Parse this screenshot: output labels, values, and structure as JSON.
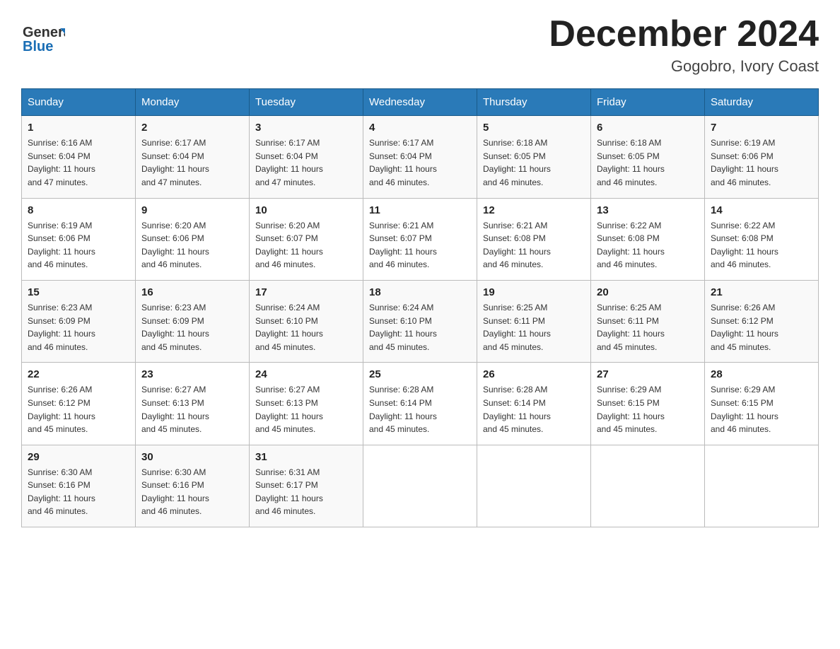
{
  "header": {
    "logo_text_general": "General",
    "logo_text_blue": "Blue",
    "month_title": "December 2024",
    "location": "Gogobro, Ivory Coast"
  },
  "weekdays": [
    "Sunday",
    "Monday",
    "Tuesday",
    "Wednesday",
    "Thursday",
    "Friday",
    "Saturday"
  ],
  "weeks": [
    [
      {
        "day": "1",
        "sunrise": "6:16 AM",
        "sunset": "6:04 PM",
        "daylight": "11 hours and 47 minutes."
      },
      {
        "day": "2",
        "sunrise": "6:17 AM",
        "sunset": "6:04 PM",
        "daylight": "11 hours and 47 minutes."
      },
      {
        "day": "3",
        "sunrise": "6:17 AM",
        "sunset": "6:04 PM",
        "daylight": "11 hours and 47 minutes."
      },
      {
        "day": "4",
        "sunrise": "6:17 AM",
        "sunset": "6:04 PM",
        "daylight": "11 hours and 46 minutes."
      },
      {
        "day": "5",
        "sunrise": "6:18 AM",
        "sunset": "6:05 PM",
        "daylight": "11 hours and 46 minutes."
      },
      {
        "day": "6",
        "sunrise": "6:18 AM",
        "sunset": "6:05 PM",
        "daylight": "11 hours and 46 minutes."
      },
      {
        "day": "7",
        "sunrise": "6:19 AM",
        "sunset": "6:06 PM",
        "daylight": "11 hours and 46 minutes."
      }
    ],
    [
      {
        "day": "8",
        "sunrise": "6:19 AM",
        "sunset": "6:06 PM",
        "daylight": "11 hours and 46 minutes."
      },
      {
        "day": "9",
        "sunrise": "6:20 AM",
        "sunset": "6:06 PM",
        "daylight": "11 hours and 46 minutes."
      },
      {
        "day": "10",
        "sunrise": "6:20 AM",
        "sunset": "6:07 PM",
        "daylight": "11 hours and 46 minutes."
      },
      {
        "day": "11",
        "sunrise": "6:21 AM",
        "sunset": "6:07 PM",
        "daylight": "11 hours and 46 minutes."
      },
      {
        "day": "12",
        "sunrise": "6:21 AM",
        "sunset": "6:08 PM",
        "daylight": "11 hours and 46 minutes."
      },
      {
        "day": "13",
        "sunrise": "6:22 AM",
        "sunset": "6:08 PM",
        "daylight": "11 hours and 46 minutes."
      },
      {
        "day": "14",
        "sunrise": "6:22 AM",
        "sunset": "6:08 PM",
        "daylight": "11 hours and 46 minutes."
      }
    ],
    [
      {
        "day": "15",
        "sunrise": "6:23 AM",
        "sunset": "6:09 PM",
        "daylight": "11 hours and 46 minutes."
      },
      {
        "day": "16",
        "sunrise": "6:23 AM",
        "sunset": "6:09 PM",
        "daylight": "11 hours and 45 minutes."
      },
      {
        "day": "17",
        "sunrise": "6:24 AM",
        "sunset": "6:10 PM",
        "daylight": "11 hours and 45 minutes."
      },
      {
        "day": "18",
        "sunrise": "6:24 AM",
        "sunset": "6:10 PM",
        "daylight": "11 hours and 45 minutes."
      },
      {
        "day": "19",
        "sunrise": "6:25 AM",
        "sunset": "6:11 PM",
        "daylight": "11 hours and 45 minutes."
      },
      {
        "day": "20",
        "sunrise": "6:25 AM",
        "sunset": "6:11 PM",
        "daylight": "11 hours and 45 minutes."
      },
      {
        "day": "21",
        "sunrise": "6:26 AM",
        "sunset": "6:12 PM",
        "daylight": "11 hours and 45 minutes."
      }
    ],
    [
      {
        "day": "22",
        "sunrise": "6:26 AM",
        "sunset": "6:12 PM",
        "daylight": "11 hours and 45 minutes."
      },
      {
        "day": "23",
        "sunrise": "6:27 AM",
        "sunset": "6:13 PM",
        "daylight": "11 hours and 45 minutes."
      },
      {
        "day": "24",
        "sunrise": "6:27 AM",
        "sunset": "6:13 PM",
        "daylight": "11 hours and 45 minutes."
      },
      {
        "day": "25",
        "sunrise": "6:28 AM",
        "sunset": "6:14 PM",
        "daylight": "11 hours and 45 minutes."
      },
      {
        "day": "26",
        "sunrise": "6:28 AM",
        "sunset": "6:14 PM",
        "daylight": "11 hours and 45 minutes."
      },
      {
        "day": "27",
        "sunrise": "6:29 AM",
        "sunset": "6:15 PM",
        "daylight": "11 hours and 45 minutes."
      },
      {
        "day": "28",
        "sunrise": "6:29 AM",
        "sunset": "6:15 PM",
        "daylight": "11 hours and 46 minutes."
      }
    ],
    [
      {
        "day": "29",
        "sunrise": "6:30 AM",
        "sunset": "6:16 PM",
        "daylight": "11 hours and 46 minutes."
      },
      {
        "day": "30",
        "sunrise": "6:30 AM",
        "sunset": "6:16 PM",
        "daylight": "11 hours and 46 minutes."
      },
      {
        "day": "31",
        "sunrise": "6:31 AM",
        "sunset": "6:17 PM",
        "daylight": "11 hours and 46 minutes."
      },
      null,
      null,
      null,
      null
    ]
  ]
}
